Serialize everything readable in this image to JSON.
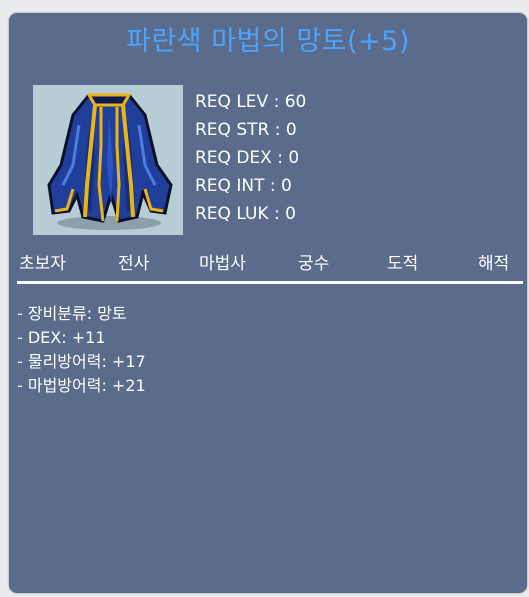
{
  "item": {
    "name": "파란색 마법의 망토(+5)",
    "image_icon": "blue-magic-cape-icon"
  },
  "requirements": [
    "REQ LEV : 60",
    "REQ STR : 0",
    "REQ DEX : 0",
    "REQ INT : 0",
    "REQ LUK : 0"
  ],
  "jobs": [
    "초보자",
    "전사",
    "마법사",
    "궁수",
    "도적",
    "해적"
  ],
  "stats": [
    "- 장비분류: 망토",
    "- DEX: +11",
    "- 물리방어력: +17",
    "- 마법방어력: +21"
  ],
  "colors": {
    "panel_bg": "#5b6b8c",
    "title": "#4aa3ff",
    "text": "#ffffff",
    "image_bg": "#b7cdd6"
  }
}
